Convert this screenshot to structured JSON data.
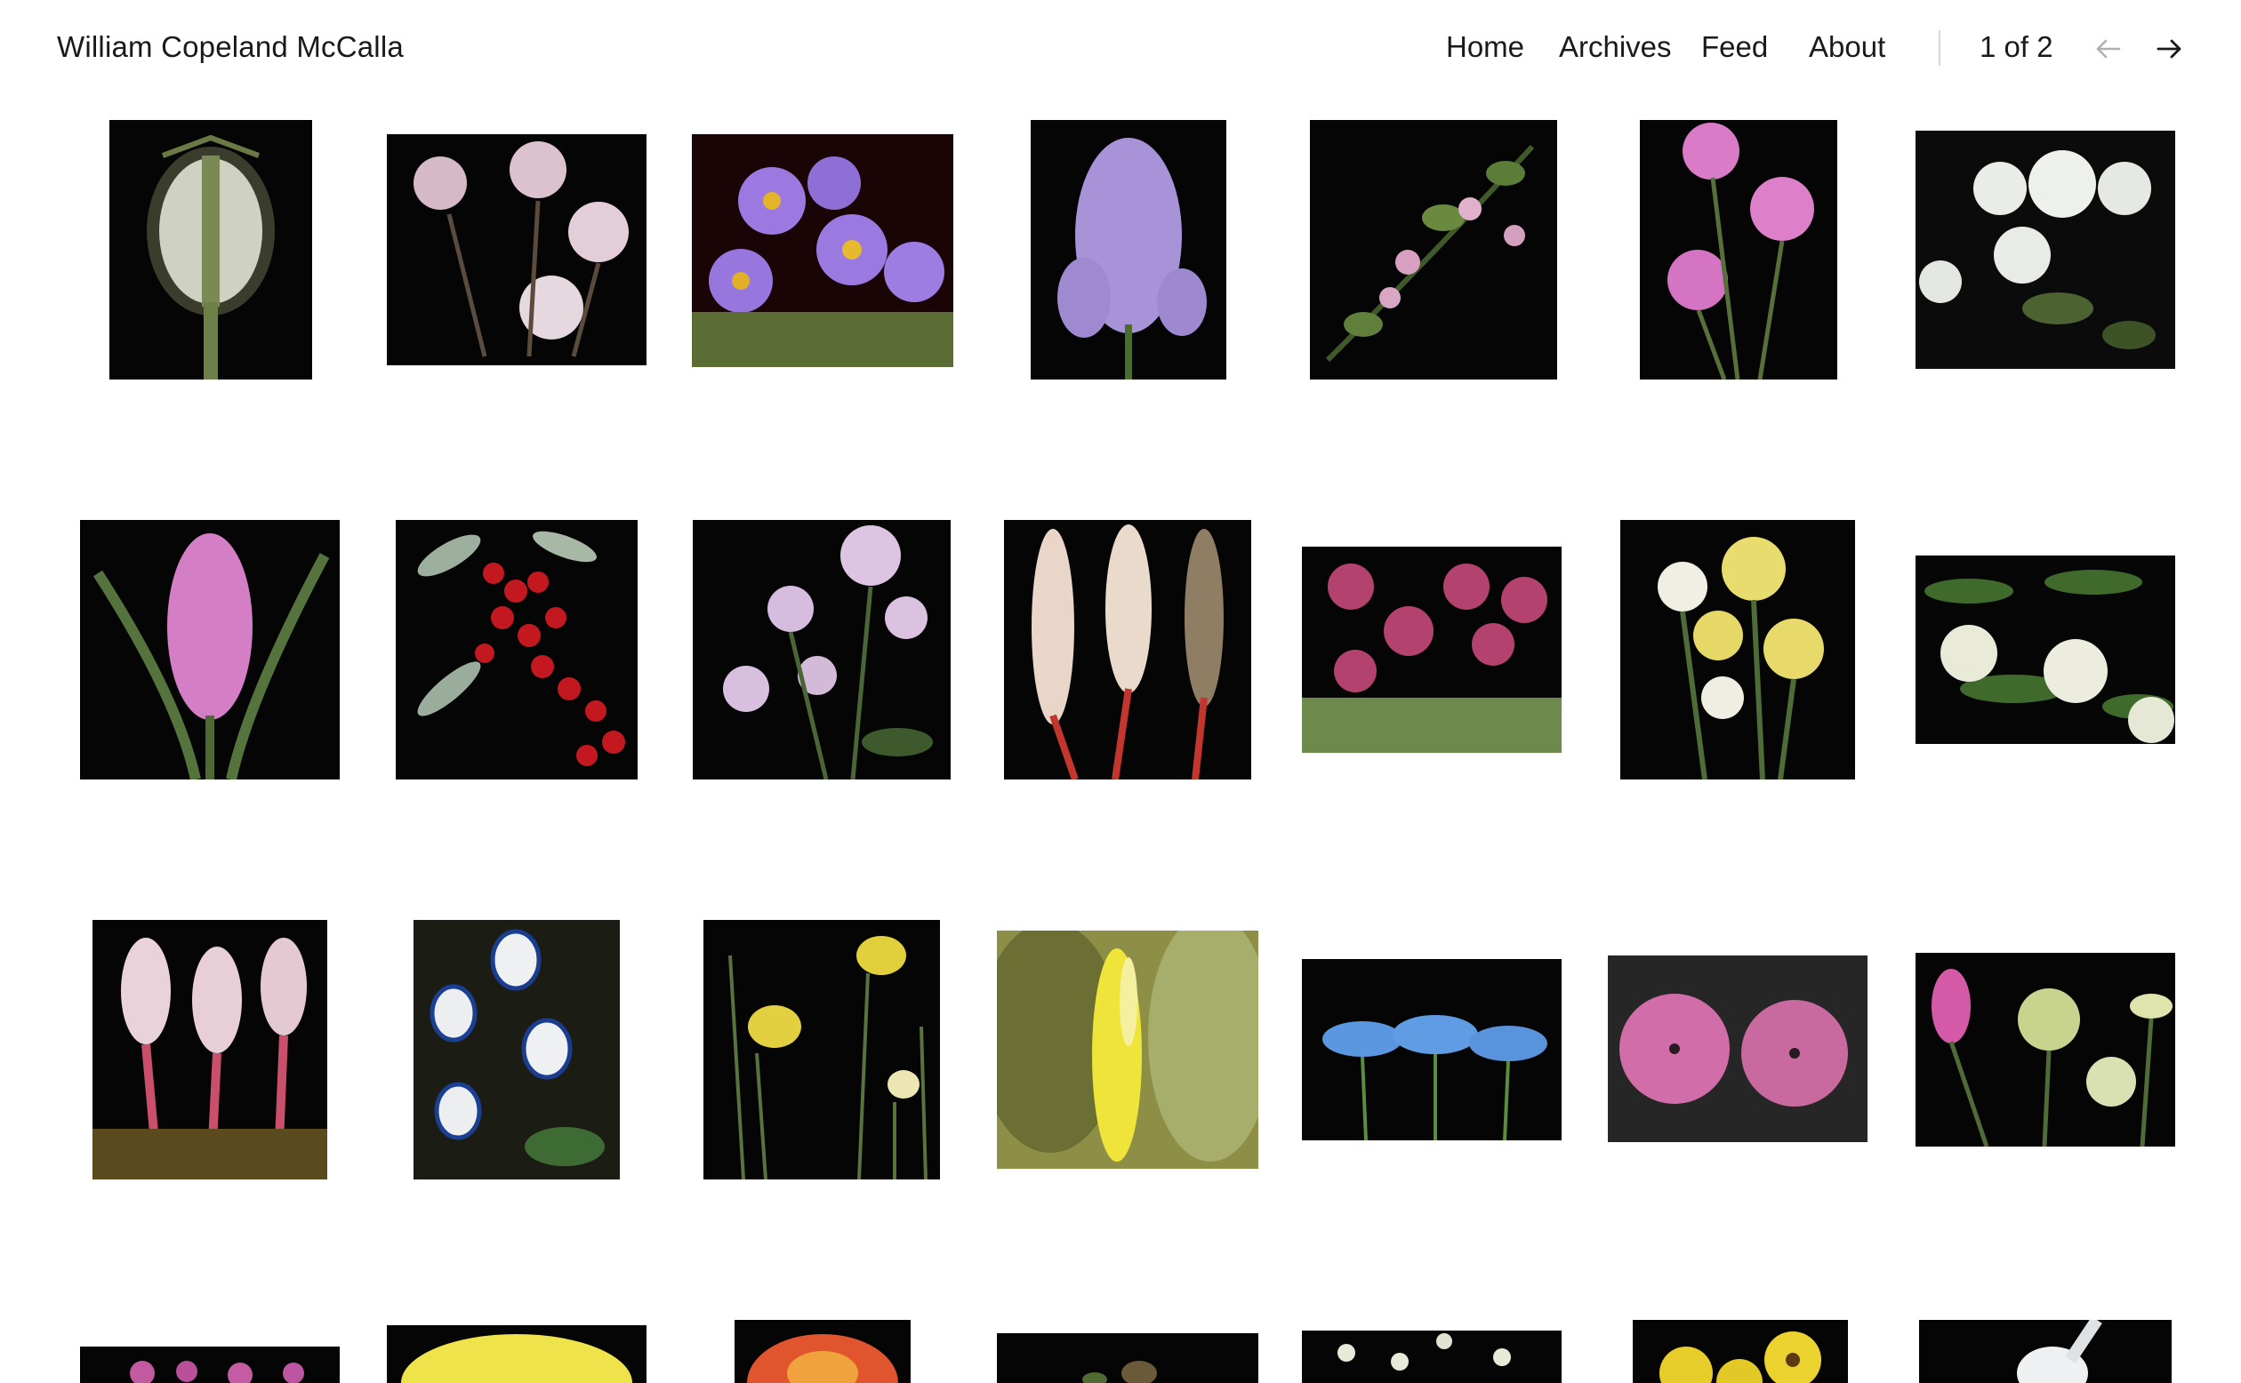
{
  "site": {
    "title": "William Copeland McCalla"
  },
  "nav": {
    "home": "Home",
    "archives": "Archives",
    "feed": "Feed",
    "about": "About"
  },
  "pager": {
    "label": "1 of 2",
    "prev_icon": "arrow-left-icon",
    "next_icon": "arrow-right-icon"
  },
  "gallery": {
    "items": [
      "poppy-seed-pod-photo",
      "clover-blossoms-photo",
      "purple-asters-photo",
      "lavender-stock-photo",
      "pink-blossom-branch-photo",
      "pink-thistle-flowers-photo",
      "white-spirea-photo",
      "pink-hyacinth-photo",
      "red-berries-branch-photo",
      "pale-phlox-photo",
      "flower-spikes-photo",
      "pink-primula-photo",
      "daffodils-photo",
      "white-elder-blossoms-photo",
      "pink-hyacinth-stems-photo",
      "blue-white-monkshood-photo",
      "yellow-daffodil-stems-photo",
      "yellow-skunk-cabbage-photo",
      "blue-nigella-photo",
      "pink-mallow-photo",
      "seed-pods-photo",
      "pink-orchid-photo",
      "yellow-chrysanthemum-photo",
      "orange-tulip-photo",
      "green-pods-photo",
      "white-bells-photo",
      "yellow-sunflowers-photo",
      "white-lily-photo"
    ]
  },
  "colors": {
    "text": "#1a1a1a",
    "background": "#ffffff",
    "divider": "#d8d8d8",
    "disabled_arrow": "#b0b0b0"
  }
}
